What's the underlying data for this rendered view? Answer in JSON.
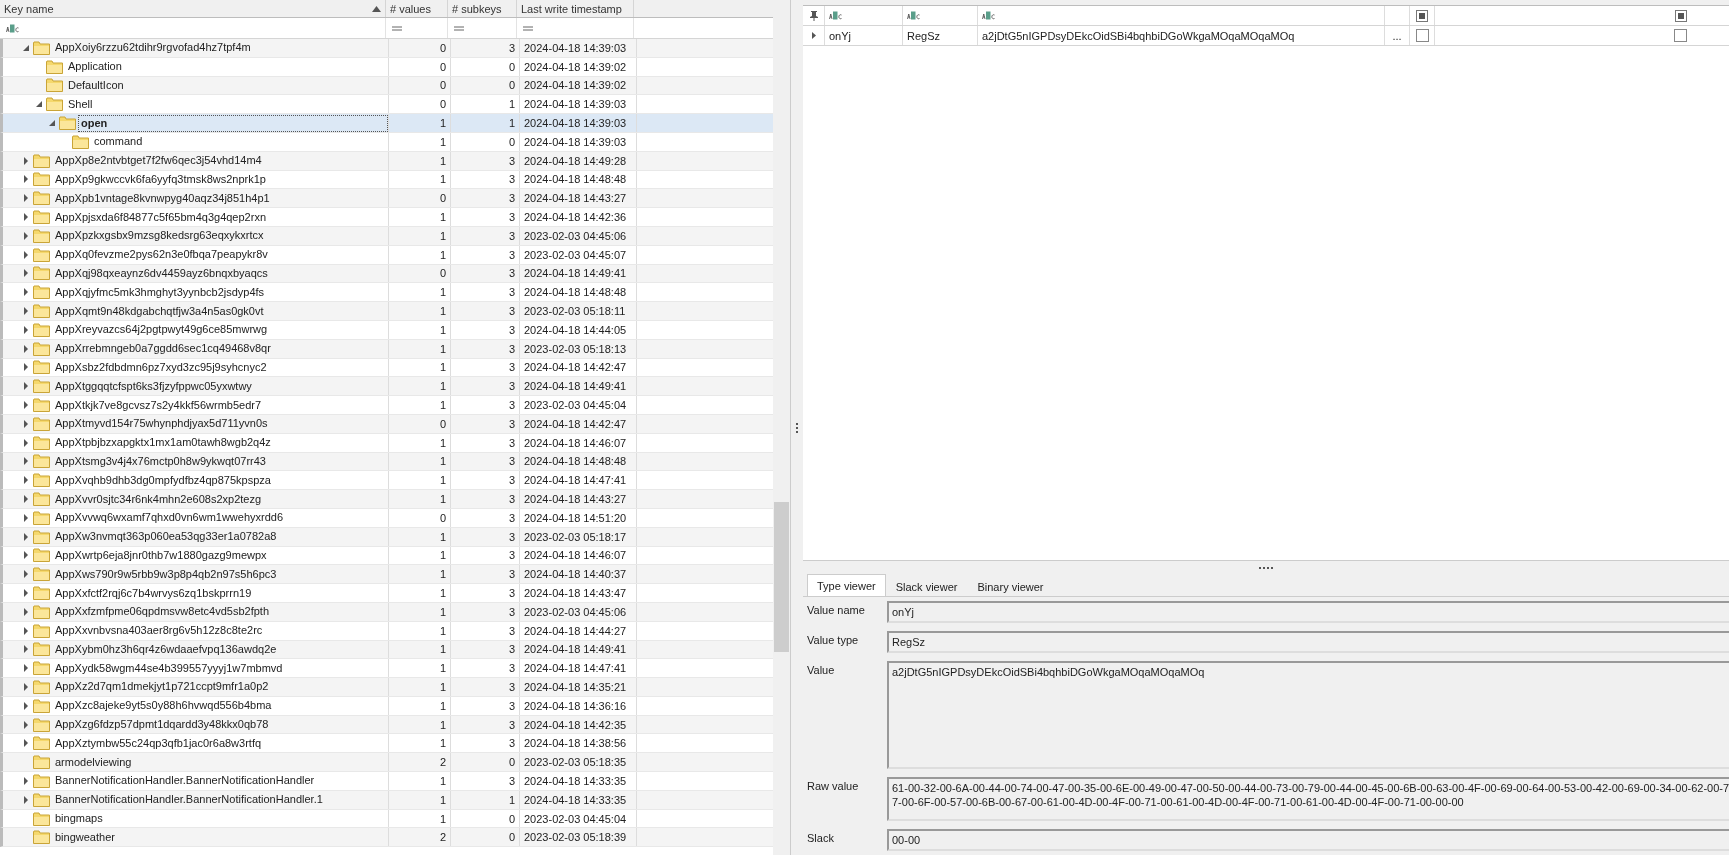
{
  "key_tree": {
    "columns": [
      {
        "label": "Key name",
        "sorted": true
      },
      {
        "label": "# values",
        "sorted": false
      },
      {
        "label": "# subkeys",
        "sorted": false
      },
      {
        "label": "Last write timestamp",
        "sorted": false
      }
    ],
    "rows": [
      {
        "name": "AppXoiy6rzzu62tdihr9rgvofad4hz7tpf4m",
        "values": "0",
        "subkeys": "3",
        "timestamp": "2024-04-18 14:39:03",
        "expanded": true,
        "selected": false,
        "children": [
          {
            "name": "Application",
            "values": "0",
            "subkeys": "0",
            "timestamp": "2024-04-18 14:39:02",
            "selected": false
          },
          {
            "name": "DefaultIcon",
            "values": "0",
            "subkeys": "0",
            "timestamp": "2024-04-18 14:39:02",
            "selected": false
          },
          {
            "name": "Shell",
            "values": "0",
            "subkeys": "1",
            "timestamp": "2024-04-18 14:39:03",
            "expanded": true,
            "selected": false,
            "children": [
              {
                "name": "open",
                "values": "1",
                "subkeys": "1",
                "timestamp": "2024-04-18 14:39:03",
                "expanded": true,
                "selected": true,
                "children": [
                  {
                    "name": "command",
                    "values": "1",
                    "subkeys": "0",
                    "timestamp": "2024-04-18 14:39:03",
                    "selected": false
                  }
                ]
              }
            ]
          }
        ]
      },
      {
        "name": "AppXp8e2ntvbtget7f2fw6qec3j54vhd14m4",
        "values": "1",
        "subkeys": "3",
        "timestamp": "2024-04-18 14:49:28",
        "expanded": false,
        "selected": false
      },
      {
        "name": "AppXp9gkwccvk6fa6yyfq3tmsk8ws2nprk1p",
        "values": "1",
        "subkeys": "3",
        "timestamp": "2024-04-18 14:48:48",
        "expanded": false,
        "selected": false
      },
      {
        "name": "AppXpb1vntage8kvnwpyg40aqz34j851h4p1",
        "values": "0",
        "subkeys": "3",
        "timestamp": "2024-04-18 14:43:27",
        "expanded": false,
        "selected": false
      },
      {
        "name": "AppXpjsxda6f84877c5f65bm4q3g4qep2rxn",
        "values": "1",
        "subkeys": "3",
        "timestamp": "2024-04-18 14:42:36",
        "expanded": false,
        "selected": false
      },
      {
        "name": "AppXpzkxgsbx9mzsg8kedsrg63eqxykxrtcx",
        "values": "1",
        "subkeys": "3",
        "timestamp": "2023-02-03 04:45:06",
        "expanded": false,
        "selected": false
      },
      {
        "name": "AppXq0fevzme2pys62n3e0fbqa7peapykr8v",
        "values": "1",
        "subkeys": "3",
        "timestamp": "2023-02-03 04:45:07",
        "expanded": false,
        "selected": false
      },
      {
        "name": "AppXqj98qxeaynz6dv4459ayz6bnqxbyaqcs",
        "values": "0",
        "subkeys": "3",
        "timestamp": "2024-04-18 14:49:41",
        "expanded": false,
        "selected": false
      },
      {
        "name": "AppXqjyfmc5mk3hmghyt3yynbcb2jsdyp4fs",
        "values": "1",
        "subkeys": "3",
        "timestamp": "2024-04-18 14:48:48",
        "expanded": false,
        "selected": false
      },
      {
        "name": "AppXqmt9n48kdgabchqtfjw3a4n5as0gk0vt",
        "values": "1",
        "subkeys": "3",
        "timestamp": "2023-02-03 05:18:11",
        "expanded": false,
        "selected": false
      },
      {
        "name": "AppXreyvazcs64j2pgtpwyt49g6ce85mwrwg",
        "values": "1",
        "subkeys": "3",
        "timestamp": "2024-04-18 14:44:05",
        "expanded": false,
        "selected": false
      },
      {
        "name": "AppXrrebmngeb0a7ggdd6sec1cq49468v8qr",
        "values": "1",
        "subkeys": "3",
        "timestamp": "2023-02-03 05:18:13",
        "expanded": false,
        "selected": false
      },
      {
        "name": "AppXsbz2fdbdmn6pz7xyd3zc95j9syhcnyc2",
        "values": "1",
        "subkeys": "3",
        "timestamp": "2024-04-18 14:42:47",
        "expanded": false,
        "selected": false
      },
      {
        "name": "AppXtggqqtcfspt6ks3fjzyfppwc05yxwtwy",
        "values": "1",
        "subkeys": "3",
        "timestamp": "2024-04-18 14:49:41",
        "expanded": false,
        "selected": false
      },
      {
        "name": "AppXtkjk7ve8gcvsz7s2y4kkf56wrmb5edr7",
        "values": "1",
        "subkeys": "3",
        "timestamp": "2023-02-03 04:45:04",
        "expanded": false,
        "selected": false
      },
      {
        "name": "AppXtmyvd154r75whynphdjyax5d711yvn0s",
        "values": "0",
        "subkeys": "3",
        "timestamp": "2024-04-18 14:42:47",
        "expanded": false,
        "selected": false
      },
      {
        "name": "AppXtpbjbzxapgktx1mx1am0tawh8wgb2q4z",
        "values": "1",
        "subkeys": "3",
        "timestamp": "2024-04-18 14:46:07",
        "expanded": false,
        "selected": false
      },
      {
        "name": "AppXtsmg3v4j4x76mctp0h8w9ykwqt07rr43",
        "values": "1",
        "subkeys": "3",
        "timestamp": "2024-04-18 14:48:48",
        "expanded": false,
        "selected": false
      },
      {
        "name": "AppXvqhb9dhb3dg0mpfydfbz4qp875kpspza",
        "values": "1",
        "subkeys": "3",
        "timestamp": "2024-04-18 14:47:41",
        "expanded": false,
        "selected": false
      },
      {
        "name": "AppXvvr0sjtc34r6nk4mhn2e608s2xp2tezg",
        "values": "1",
        "subkeys": "3",
        "timestamp": "2024-04-18 14:43:27",
        "expanded": false,
        "selected": false
      },
      {
        "name": "AppXvvwq6wxamf7qhxd0vn6wm1wwehyxrdd6",
        "values": "0",
        "subkeys": "3",
        "timestamp": "2024-04-18 14:51:20",
        "expanded": false,
        "selected": false
      },
      {
        "name": "AppXw3nvmqt363p060ea53qg33er1a0782a8",
        "values": "1",
        "subkeys": "3",
        "timestamp": "2023-02-03 05:18:17",
        "expanded": false,
        "selected": false
      },
      {
        "name": "AppXwrtp6eja8jnr0thb7w1880gazg9mewpx",
        "values": "1",
        "subkeys": "3",
        "timestamp": "2024-04-18 14:46:07",
        "expanded": false,
        "selected": false
      },
      {
        "name": "AppXws790r9w5rbb9w3p8p4qb2n97s5h6pc3",
        "values": "1",
        "subkeys": "3",
        "timestamp": "2024-04-18 14:40:37",
        "expanded": false,
        "selected": false
      },
      {
        "name": "AppXxfctf2rqj6c7b4wrvys6zq1bskprrn19",
        "values": "1",
        "subkeys": "3",
        "timestamp": "2024-04-18 14:43:47",
        "expanded": false,
        "selected": false
      },
      {
        "name": "AppXxfzmfpme06qpdmsvw8etc4vd5sb2fpth",
        "values": "1",
        "subkeys": "3",
        "timestamp": "2023-02-03 04:45:06",
        "expanded": false,
        "selected": false
      },
      {
        "name": "AppXxvnbvsna403aer8rg6v5h12z8c8te2rc",
        "values": "1",
        "subkeys": "3",
        "timestamp": "2024-04-18 14:44:27",
        "expanded": false,
        "selected": false
      },
      {
        "name": "AppXybm0hz3h6qr4z6wdaaefvpq136awdq2e",
        "values": "1",
        "subkeys": "3",
        "timestamp": "2024-04-18 14:49:41",
        "expanded": false,
        "selected": false
      },
      {
        "name": "AppXydk58wgm44se4b399557yyyj1w7mbmvd",
        "values": "1",
        "subkeys": "3",
        "timestamp": "2024-04-18 14:47:41",
        "expanded": false,
        "selected": false
      },
      {
        "name": "AppXz2d7qm1dmekjyt1p721ccpt9mfr1a0p2",
        "values": "1",
        "subkeys": "3",
        "timestamp": "2024-04-18 14:35:21",
        "expanded": false,
        "selected": false
      },
      {
        "name": "AppXzc8ajeke9yt5s0y88h6hvwqd556b4bma",
        "values": "1",
        "subkeys": "3",
        "timestamp": "2024-04-18 14:36:16",
        "expanded": false,
        "selected": false
      },
      {
        "name": "AppXzg6fdzp57dpmt1dqardd3y48kkx0qb78",
        "values": "1",
        "subkeys": "3",
        "timestamp": "2024-04-18 14:42:35",
        "expanded": false,
        "selected": false
      },
      {
        "name": "AppXztymbw55c24qp3qfb1jac0r6a8w3rtfq",
        "values": "1",
        "subkeys": "3",
        "timestamp": "2024-04-18 14:38:56",
        "expanded": false,
        "selected": false
      },
      {
        "name": "armodelviewing",
        "values": "2",
        "subkeys": "0",
        "timestamp": "2023-02-03 05:18:35",
        "selected": false
      },
      {
        "name": "BannerNotificationHandler.BannerNotificationHandler",
        "values": "1",
        "subkeys": "3",
        "timestamp": "2024-04-18 14:33:35",
        "expanded": false,
        "selected": false
      },
      {
        "name": "BannerNotificationHandler.BannerNotificationHandler.1",
        "values": "1",
        "subkeys": "1",
        "timestamp": "2024-04-18 14:33:35",
        "expanded": false,
        "selected": false
      },
      {
        "name": "bingmaps",
        "values": "1",
        "subkeys": "0",
        "timestamp": "2023-02-03 04:45:04",
        "selected": false
      },
      {
        "name": "bingweather",
        "values": "2",
        "subkeys": "0",
        "timestamp": "2023-02-03 05:18:39",
        "selected": false
      }
    ]
  },
  "values_grid": {
    "rows": [
      {
        "name": "onYj",
        "type": "RegSz",
        "data": "a2jDtG5nIGPDsyDEkcOidSBi4bqhbiDGoWkgaMOqaMOqaMOq",
        "button": "...",
        "flag_1": false,
        "flag_2": false
      }
    ]
  },
  "viewer": {
    "tabs": [
      {
        "label": "Type viewer",
        "selected": true
      },
      {
        "label": "Slack viewer",
        "selected": false
      },
      {
        "label": "Binary viewer",
        "selected": false
      }
    ],
    "fields": [
      {
        "label": "Value name",
        "kind": "line",
        "lines": [
          "onYj"
        ]
      },
      {
        "label": "Value type",
        "kind": "line",
        "lines": [
          "RegSz"
        ]
      },
      {
        "label": "Value",
        "kind": "area",
        "lines": [
          "a2jDtG5nIGPDsyDEkcOidSBi4bqhbiDGoWkgaMOqaMOqaMOq"
        ]
      },
      {
        "label": "Raw value",
        "kind": "multi",
        "lines": [
          "61-00-32-00-6A-00-44-00-74-00-47-00-35-00-6E-00-49-00-47-00-50-00-44-00-73-00-79-00-44-00-45-00-6B-00-63-00-4F-00-69-00-64-00-53-00-42-00-69-00-34-00-62-00-7",
          "7-00-6F-00-57-00-6B-00-67-00-61-00-4D-00-4F-00-71-00-61-00-4D-00-4F-00-71-00-61-00-4D-00-4F-00-71-00-00-00"
        ]
      },
      {
        "label": "Slack",
        "kind": "line",
        "lines": [
          "00-00"
        ]
      }
    ]
  }
}
